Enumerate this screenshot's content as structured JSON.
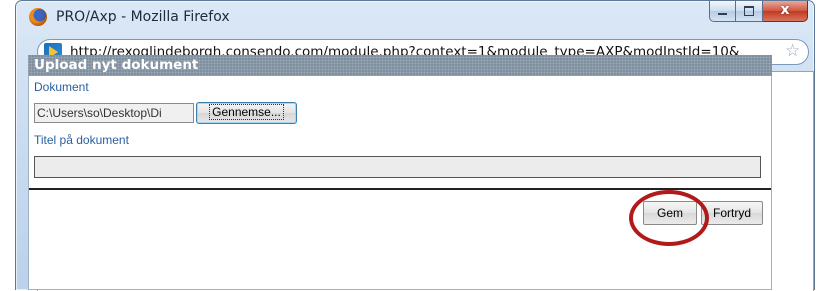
{
  "window": {
    "title": "PRO/Axp - Mozilla Firefox",
    "close_glyph": "x"
  },
  "addressbar": {
    "url": "http://rexoglindeborgh.consendo.com/module.php?context=1&module_type=AXP&modInstId=10&",
    "star_glyph": "☆"
  },
  "panel": {
    "header": "Upload nyt dokument",
    "document_label": "Dokument",
    "file_value": "C:\\Users\\so\\Desktop\\Di",
    "browse_label": "Gennemse...",
    "title_label": "Titel på dokument",
    "title_value": "",
    "save_label": "Gem",
    "cancel_label": "Fortryd"
  },
  "colors": {
    "header_bg": "#7e8f9f",
    "label_blue": "#2a5f9e",
    "highlight_red": "#b21a1a"
  },
  "icons": {
    "app": "firefox-icon",
    "site": "site-favicon-icon",
    "bookmark": "star-icon"
  }
}
